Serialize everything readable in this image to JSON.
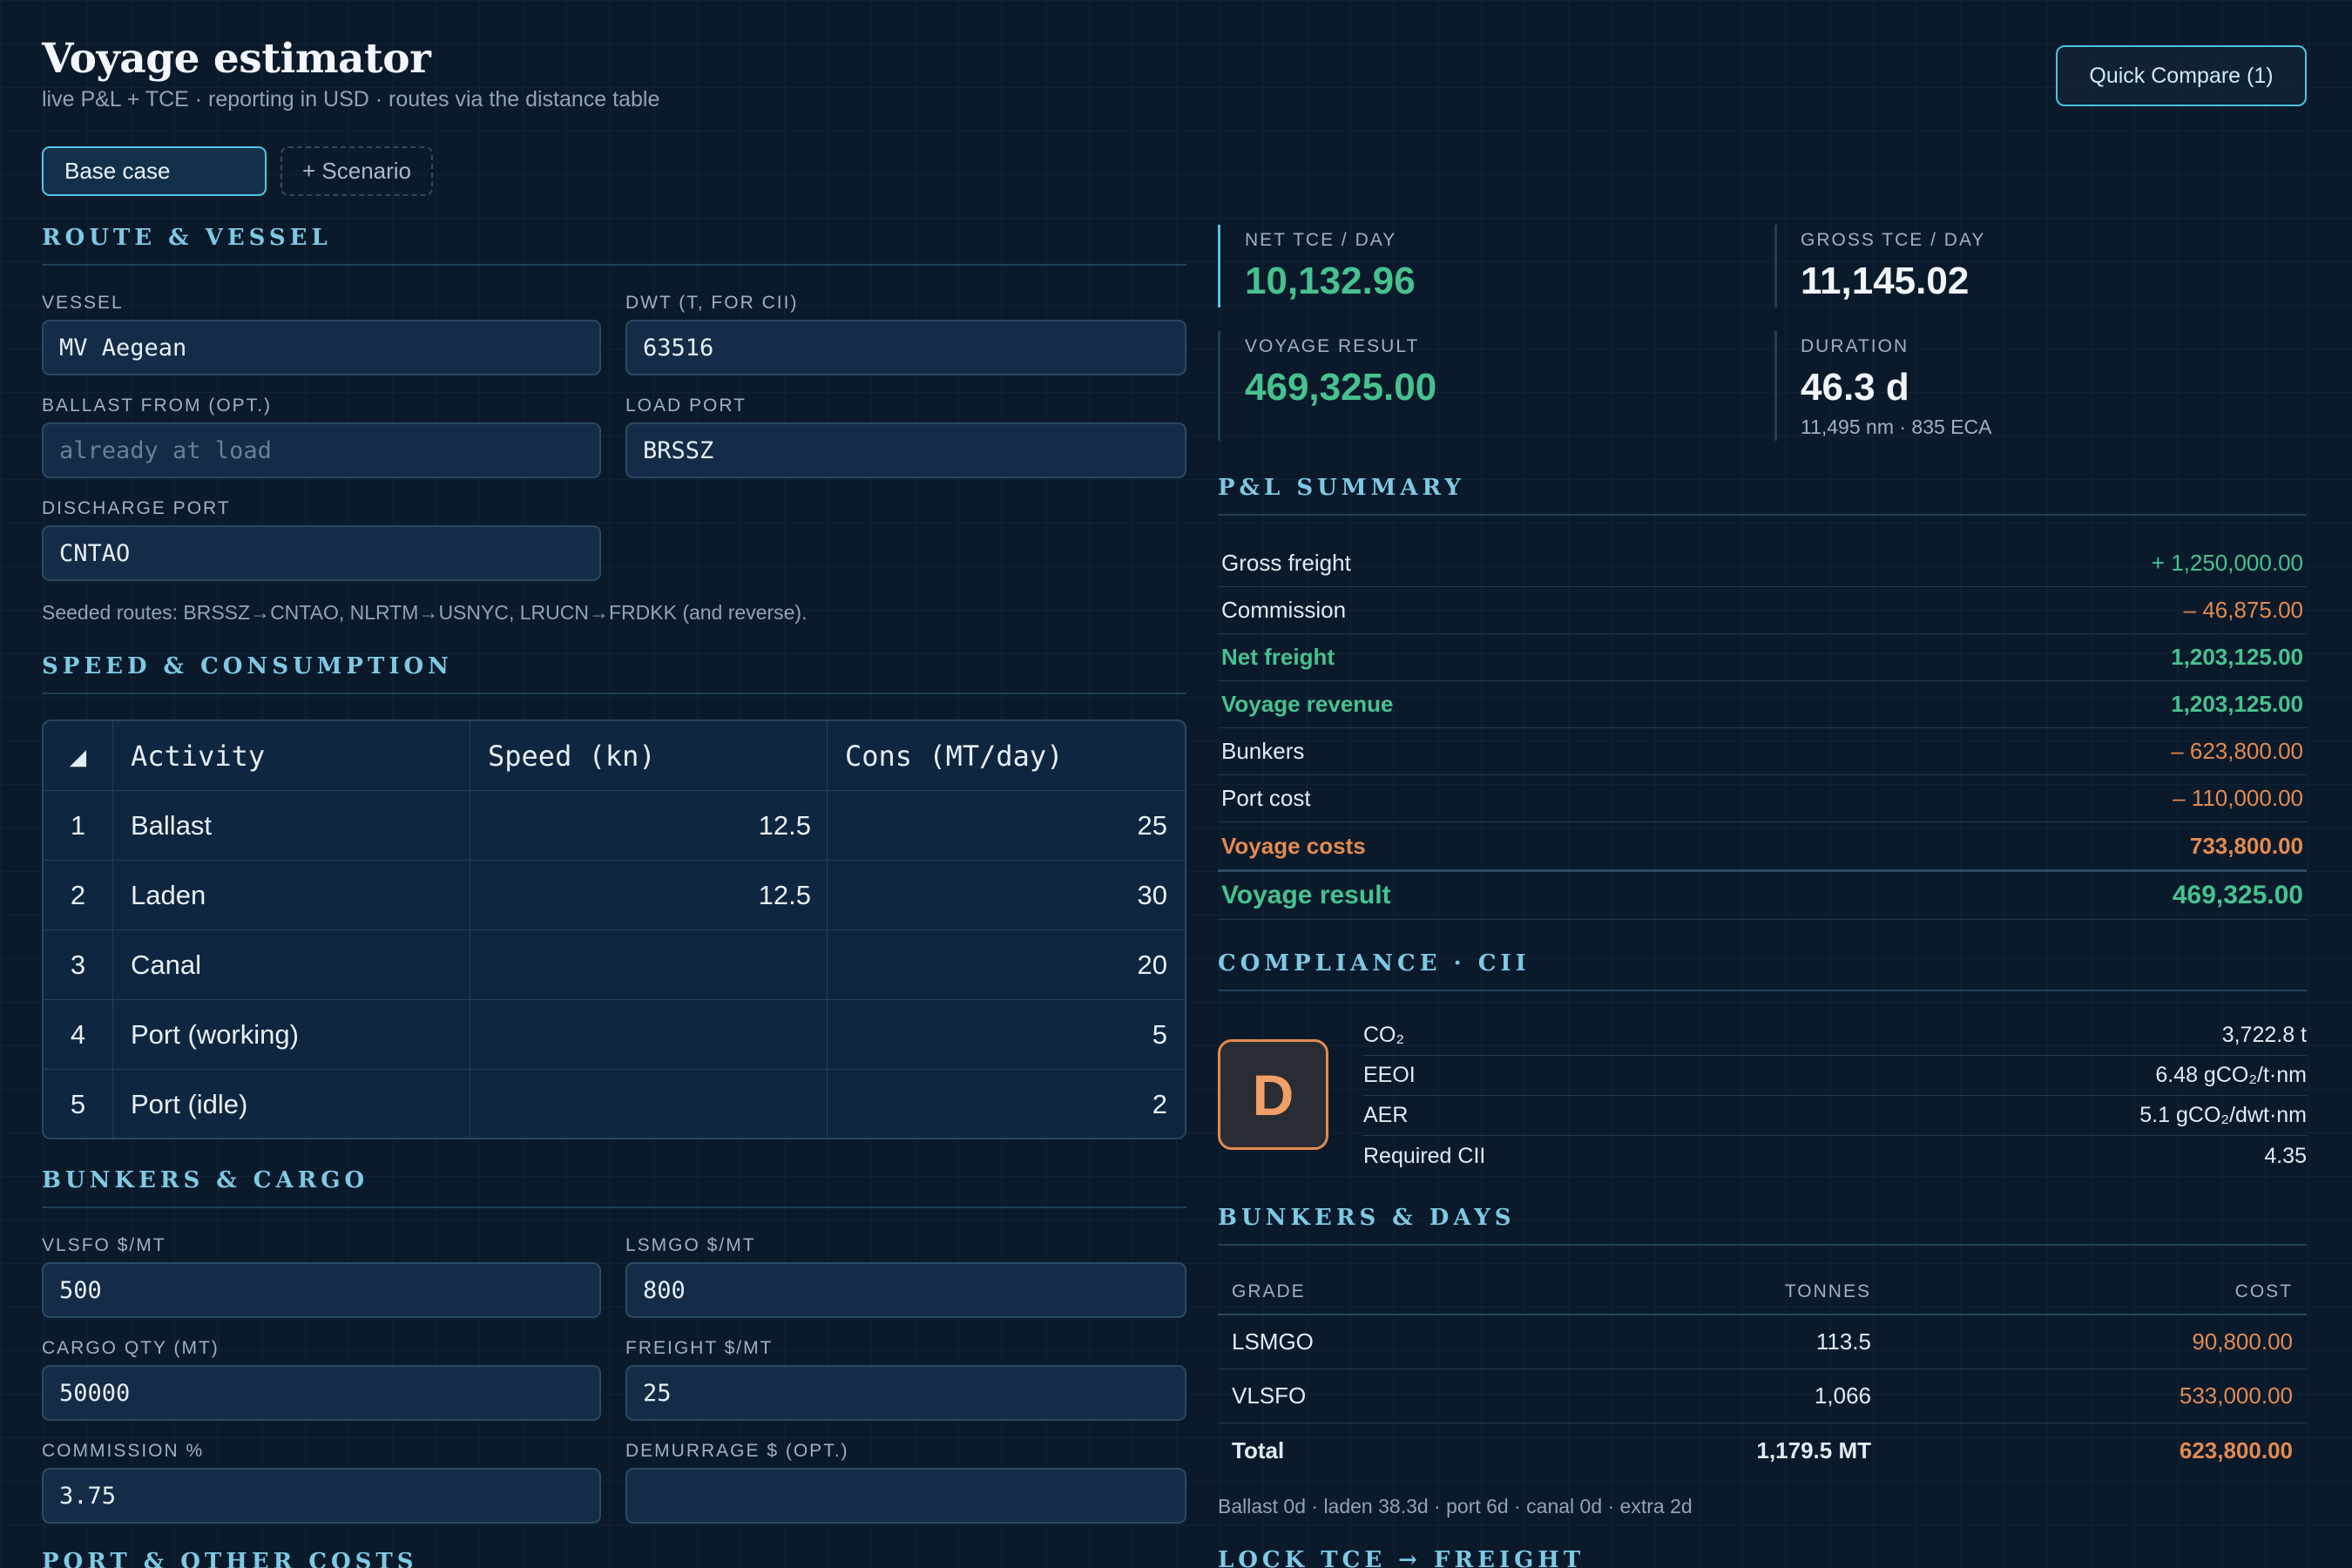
{
  "header": {
    "title": "Voyage estimator",
    "subtitle": "live P&L + TCE · reporting in USD · routes via the distance table",
    "quick_compare_label": "Quick Compare (1)"
  },
  "tabs": {
    "base_label": "Base case",
    "scenario_label": "+ Scenario"
  },
  "route_vessel": {
    "section_title": "ROUTE & VESSEL",
    "vessel": {
      "label": "VESSEL",
      "value": "MV Aegean"
    },
    "dwt": {
      "label": "DWT (T, FOR CII)",
      "value": "63516"
    },
    "ballast_from": {
      "label": "BALLAST FROM (OPT.)",
      "placeholder": "already at load"
    },
    "load_port": {
      "label": "LOAD PORT",
      "value": "BRSSZ"
    },
    "discharge_port": {
      "label": "DISCHARGE PORT",
      "value": "CNTAO"
    },
    "note": "Seeded routes: BRSSZ→CNTAO, NLRTM→USNYC, LRUCN→FRDKK (and reverse)."
  },
  "speed_consumption": {
    "section_title": "SPEED & CONSUMPTION",
    "corner_icon": "sort-triangle-icon",
    "headers": [
      "Activity",
      "Speed (kn)",
      "Cons (MT/day)"
    ],
    "rows": [
      {
        "n": "1",
        "activity": "Ballast",
        "speed": "12.5",
        "cons": "25"
      },
      {
        "n": "2",
        "activity": "Laden",
        "speed": "12.5",
        "cons": "30"
      },
      {
        "n": "3",
        "activity": "Canal",
        "speed": "",
        "cons": "20"
      },
      {
        "n": "4",
        "activity": "Port (working)",
        "speed": "",
        "cons": "5"
      },
      {
        "n": "5",
        "activity": "Port (idle)",
        "speed": "",
        "cons": "2"
      }
    ]
  },
  "bunkers_cargo": {
    "section_title": "BUNKERS & CARGO",
    "vlsfo": {
      "label": "VLSFO $/MT",
      "value": "500"
    },
    "lsmgo": {
      "label": "LSMGO $/MT",
      "value": "800"
    },
    "cargo_qty": {
      "label": "CARGO QTY (MT)",
      "value": "50000"
    },
    "freight": {
      "label": "FREIGHT $/MT",
      "value": "25"
    },
    "commission": {
      "label": "COMMISSION %",
      "value": "3.75"
    },
    "demurrage": {
      "label": "DEMURRAGE $ (OPT.)",
      "value": ""
    }
  },
  "port_costs": {
    "section_title": "PORT & OTHER COSTS"
  },
  "kpis": {
    "net_tce": {
      "label": "NET TCE / DAY",
      "value": "10,132.96"
    },
    "gross_tce": {
      "label": "GROSS TCE / DAY",
      "value": "11,145.02"
    },
    "voyage_result": {
      "label": "VOYAGE RESULT",
      "value": "469,325.00"
    },
    "duration": {
      "label": "DURATION",
      "value": "46.3 d",
      "sub": "11,495 nm · 835 ECA"
    }
  },
  "pl_summary": {
    "section_title": "P&L SUMMARY",
    "rows": [
      {
        "label": "Gross freight",
        "value": "+ 1,250,000.00",
        "tone": "green",
        "bold": false
      },
      {
        "label": "Commission",
        "value": "– 46,875.00",
        "tone": "orange",
        "bold": false
      },
      {
        "label": "Net freight",
        "value": "1,203,125.00",
        "tone": "green",
        "bold": true
      },
      {
        "label": "Voyage revenue",
        "value": "1,203,125.00",
        "tone": "green",
        "bold": true
      },
      {
        "label": "Bunkers",
        "value": "– 623,800.00",
        "tone": "orange",
        "bold": false
      },
      {
        "label": "Port cost",
        "value": "– 110,000.00",
        "tone": "orange",
        "bold": false
      },
      {
        "label": "Voyage costs",
        "value": "733,800.00",
        "tone": "orange",
        "bold": true
      },
      {
        "label": "Voyage result",
        "value": "469,325.00",
        "tone": "green",
        "bold": true
      }
    ]
  },
  "compliance": {
    "section_title": "COMPLIANCE · CII",
    "grade": "D",
    "rows": [
      {
        "label": "CO₂",
        "value": "3,722.8 t"
      },
      {
        "label": "EEOI",
        "value": "6.48 gCO₂/t·nm"
      },
      {
        "label": "AER",
        "value": "5.1 gCO₂/dwt·nm"
      },
      {
        "label": "Required CII",
        "value": "4.35"
      }
    ]
  },
  "bunkers_days": {
    "section_title": "BUNKERS & DAYS",
    "headers": [
      "GRADE",
      "TONNES",
      "COST"
    ],
    "rows": [
      {
        "grade": "LSMGO",
        "tonnes": "113.5",
        "cost": "90,800.00"
      },
      {
        "grade": "VLSFO",
        "tonnes": "1,066",
        "cost": "533,000.00"
      }
    ],
    "total": {
      "grade": "Total",
      "tonnes": "1,179.5 MT",
      "cost": "623,800.00"
    },
    "days_note": "Ballast 0d · laden 38.3d · port 6d · canal 0d · extra 2d"
  },
  "lock_tce": {
    "section_title": "LOCK TCE → FREIGHT"
  },
  "colors": {
    "accent": "#4fc3e0",
    "positive": "#46c28f",
    "negative": "#e38a4f",
    "background": "#0b1a2b"
  }
}
